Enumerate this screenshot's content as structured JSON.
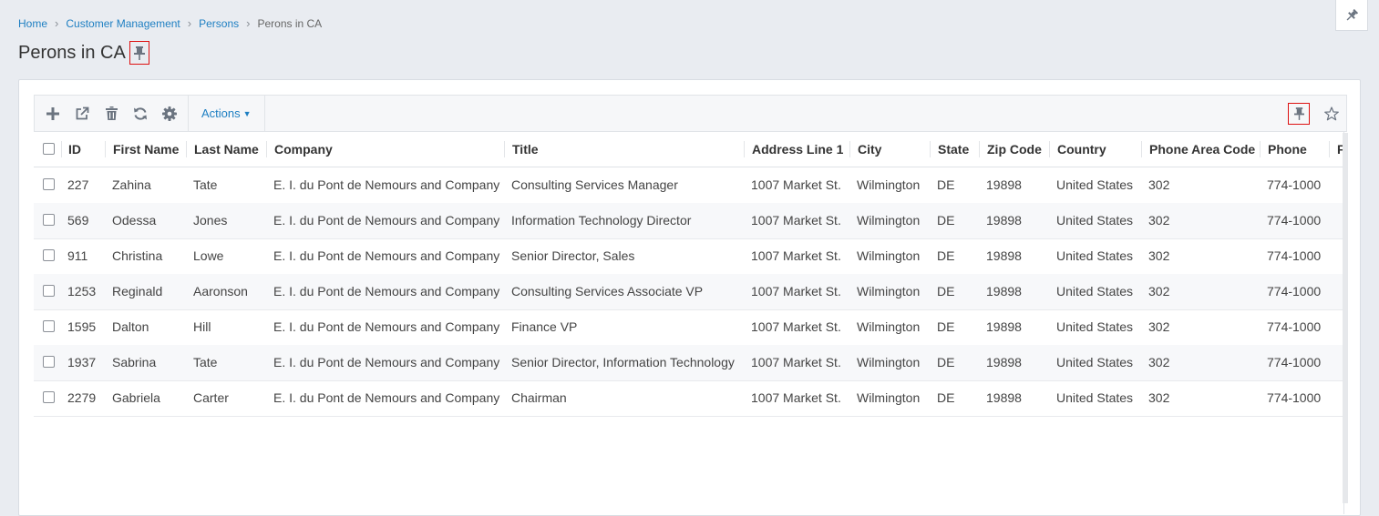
{
  "breadcrumb": {
    "home": "Home",
    "customer_management": "Customer Management",
    "persons": "Persons",
    "current": "Perons in CA"
  },
  "page": {
    "title": "Perons in CA"
  },
  "toolbar": {
    "actions_label": "Actions",
    "actions_caret": "▼"
  },
  "grid": {
    "columns": [
      "ID",
      "First Name",
      "Last Name",
      "Company",
      "Title",
      "Address Line 1",
      "City",
      "State",
      "Zip Code",
      "Country",
      "Phone Area Code",
      "Phone",
      "F"
    ],
    "rows": [
      {
        "id": "227",
        "first": "Zahina",
        "last": "Tate",
        "company": "E. I. du Pont de Nemours and Company",
        "title": "Consulting Services Manager",
        "address": "1007 Market St.",
        "city": "Wilmington",
        "state": "DE",
        "zip": "19898",
        "country": "United States",
        "area": "302",
        "phone": "774-1000"
      },
      {
        "id": "569",
        "first": "Odessa",
        "last": "Jones",
        "company": "E. I. du Pont de Nemours and Company",
        "title": "Information Technology Director",
        "address": "1007 Market St.",
        "city": "Wilmington",
        "state": "DE",
        "zip": "19898",
        "country": "United States",
        "area": "302",
        "phone": "774-1000"
      },
      {
        "id": "911",
        "first": "Christina",
        "last": "Lowe",
        "company": "E. I. du Pont de Nemours and Company",
        "title": "Senior Director, Sales",
        "address": "1007 Market St.",
        "city": "Wilmington",
        "state": "DE",
        "zip": "19898",
        "country": "United States",
        "area": "302",
        "phone": "774-1000"
      },
      {
        "id": "1253",
        "first": "Reginald",
        "last": "Aaronson",
        "company": "E. I. du Pont de Nemours and Company",
        "title": "Consulting Services Associate VP",
        "address": "1007 Market St.",
        "city": "Wilmington",
        "state": "DE",
        "zip": "19898",
        "country": "United States",
        "area": "302",
        "phone": "774-1000"
      },
      {
        "id": "1595",
        "first": "Dalton",
        "last": "Hill",
        "company": "E. I. du Pont de Nemours and Company",
        "title": "Finance VP",
        "address": "1007 Market St.",
        "city": "Wilmington",
        "state": "DE",
        "zip": "19898",
        "country": "United States",
        "area": "302",
        "phone": "774-1000"
      },
      {
        "id": "1937",
        "first": "Sabrina",
        "last": "Tate",
        "company": "E. I. du Pont de Nemours and Company",
        "title": "Senior Director, Information Technology",
        "address": "1007 Market St.",
        "city": "Wilmington",
        "state": "DE",
        "zip": "19898",
        "country": "United States",
        "area": "302",
        "phone": "774-1000"
      },
      {
        "id": "2279",
        "first": "Gabriela",
        "last": "Carter",
        "company": "E. I. du Pont de Nemours and Company",
        "title": "Chairman",
        "address": "1007 Market St.",
        "city": "Wilmington",
        "state": "DE",
        "zip": "19898",
        "country": "United States",
        "area": "302",
        "phone": "774-1000"
      }
    ]
  },
  "icons": {
    "add": "plus-icon",
    "open": "external-link-icon",
    "delete": "trash-icon",
    "refresh": "refresh-icon",
    "settings": "gear-icon",
    "pin": "pin-icon",
    "favorite": "star-icon"
  },
  "colors": {
    "link": "#1e7fc2",
    "icon": "#6b7480",
    "highlight_border": "#dd1111"
  }
}
